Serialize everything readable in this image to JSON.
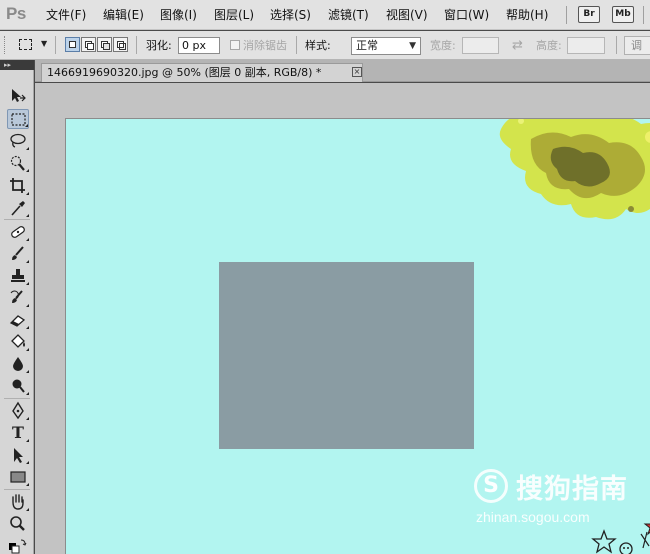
{
  "app": {
    "logo": "Ps"
  },
  "menu": {
    "items": [
      "文件(F)",
      "编辑(E)",
      "图像(I)",
      "图层(L)",
      "选择(S)",
      "滤镜(T)",
      "视图(V)",
      "窗口(W)",
      "帮助(H)"
    ],
    "bridge_chip": "Br",
    "minibridge_chip": "Mb"
  },
  "options": {
    "feather_label": "羽化:",
    "feather_value": "0 px",
    "antialias_label": "消除锯齿",
    "style_label": "样式:",
    "style_value": "正常",
    "width_label": "宽度:",
    "height_label": "高度:",
    "adjust_label": "调"
  },
  "document": {
    "tab_title": "1466919690320.jpg @ 50% (图层 0 副本, RGB/8) *",
    "close_glyph": "×"
  },
  "toolbox": {
    "header": "▸▸",
    "tools": [
      "move-tool",
      "rectangular-marquee-tool",
      "lasso-tool",
      "quick-selection-tool",
      "crop-tool",
      "eyedropper-tool",
      "spot-healing-brush-tool",
      "brush-tool",
      "clone-stamp-tool",
      "history-brush-tool",
      "eraser-tool",
      "paint-bucket-tool",
      "blur-tool",
      "dodge-tool",
      "pen-tool",
      "type-tool",
      "path-selection-tool",
      "rectangle-tool",
      "hand-tool",
      "zoom-tool"
    ],
    "selected_tool": "rectangular-marquee-tool",
    "type_tool_glyph": "T"
  },
  "colors": {
    "canvas_background": "#b2f5f0",
    "selection_fill": "#8a9ca3",
    "workspace": "#c3c3c3"
  },
  "watermark": {
    "logo": "S",
    "text": "搜狗指南",
    "sub": "zhinan.sogou.com"
  }
}
